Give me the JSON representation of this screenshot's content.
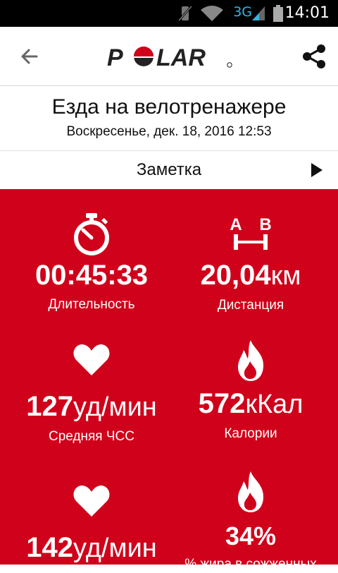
{
  "status_bar": {
    "network": "3G",
    "time": "14:01"
  },
  "header": {
    "logo_text": "POLAR"
  },
  "workout": {
    "title": "Езда на велотренажере",
    "datetime": "Воскресенье, дек. 18, 2016 12:53"
  },
  "note": {
    "label": "Заметка"
  },
  "stats": [
    {
      "icon": "stopwatch-icon",
      "value": "00:45:33",
      "unit": "",
      "label": "Длительность"
    },
    {
      "icon": "distance-ab-icon",
      "value": "20,04",
      "unit": "км",
      "label": "Дистанция",
      "icon_letters": [
        "A",
        "B"
      ]
    },
    {
      "icon": "heart-icon",
      "value": "127",
      "unit": "уд/мин",
      "label": "Средняя ЧСС"
    },
    {
      "icon": "flame-icon",
      "value": "572",
      "unit": "кКал",
      "label": "Калории"
    },
    {
      "icon": "heart-icon",
      "value": "142",
      "unit": "уд/мин",
      "label": ""
    },
    {
      "icon": "flame-icon",
      "value": "34%",
      "unit": "",
      "label": "% жира в сожженных"
    }
  ],
  "colors": {
    "accent": "#d0021b",
    "text_on_accent": "#ffffff"
  }
}
